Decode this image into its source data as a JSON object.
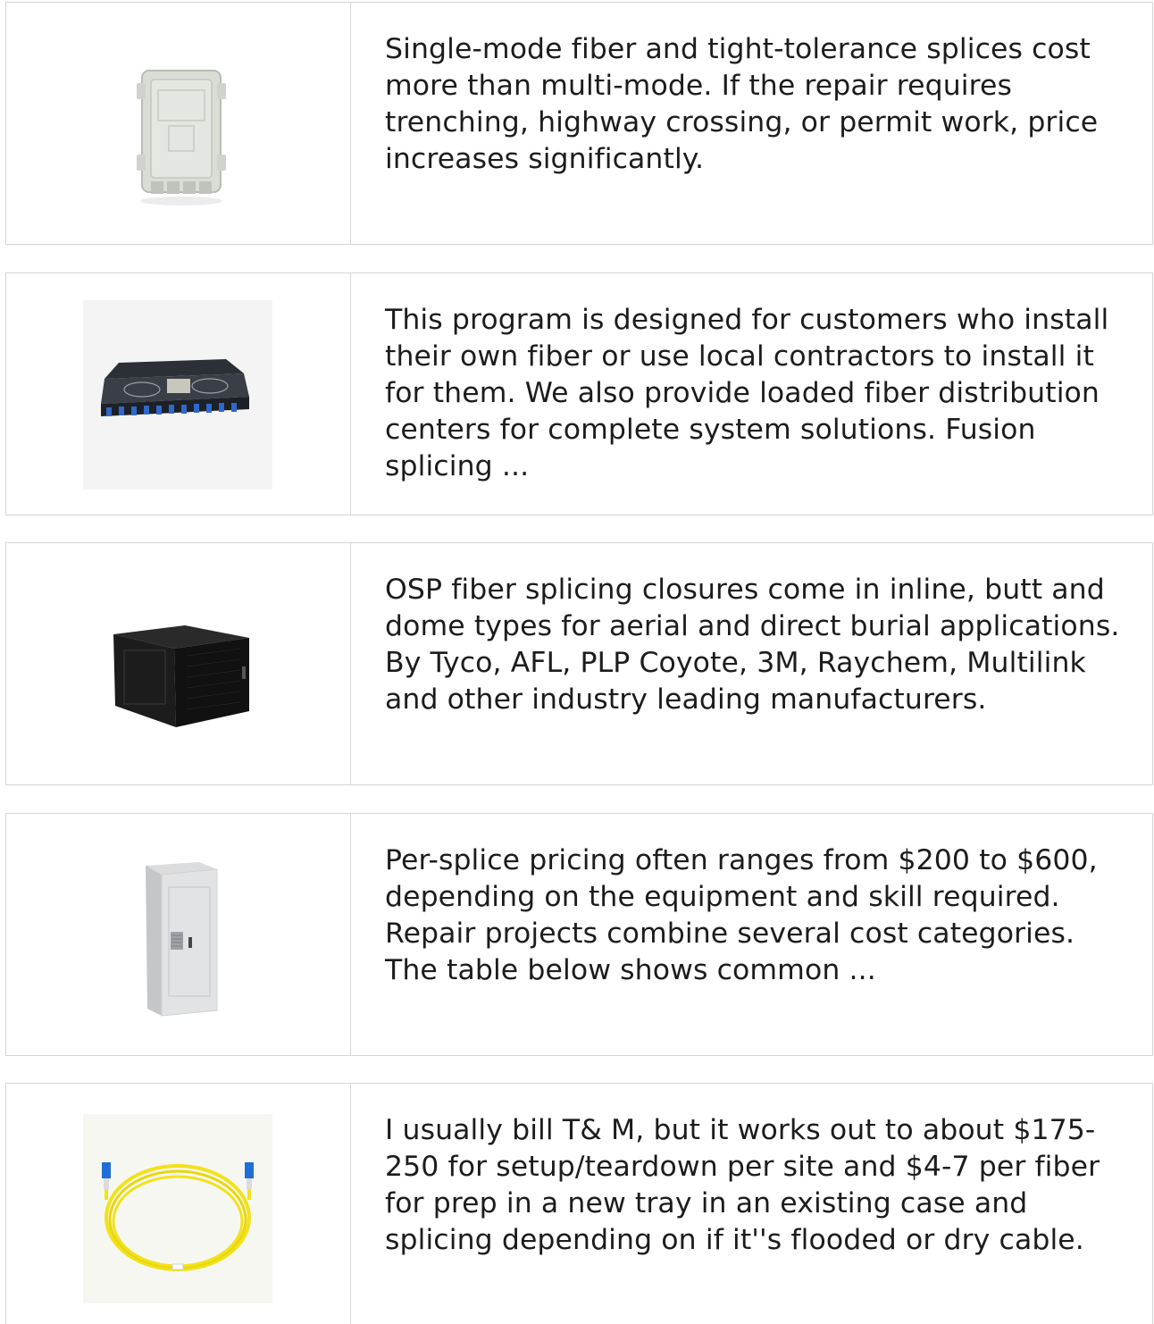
{
  "items": [
    {
      "icon": "splice-closure-box-icon",
      "text": "Single-mode fiber and tight-tolerance splices cost more than multi-mode. If the repair requires trenching, highway crossing, or permit work, price increases significantly."
    },
    {
      "icon": "rack-splice-tray-icon",
      "text": "This program is designed for customers who install their own fiber or use local contractors to install it for them. We also provide loaded fiber distribution centers for complete system solutions. Fusion splicing ..."
    },
    {
      "icon": "wall-mount-cabinet-icon",
      "text": "OSP fiber splicing closures come in inline, butt and dome types for aerial and direct burial applications. By Tyco, AFL, PLP Coyote, 3M, Raychem, Multilink and other industry leading manufacturers."
    },
    {
      "icon": "outdoor-cabinet-icon",
      "text": "Per-splice pricing often ranges from $200 to $600, depending on the equipment and skill required. Repair projects combine several cost categories. The table below shows common ..."
    },
    {
      "icon": "fiber-patch-cord-icon",
      "text": "I usually bill T& M, but it works out to about $175-250 for setup/teardown per site and $4-7 per fiber for prep in a new tray in an existing case and splicing depending on if it''s flooded or dry cable."
    }
  ],
  "colors": {
    "border": "#d6d6d6",
    "text": "#1c1c1c",
    "fiber_yellow": "#f2e21a",
    "connector_blue": "#1f6fd6"
  }
}
